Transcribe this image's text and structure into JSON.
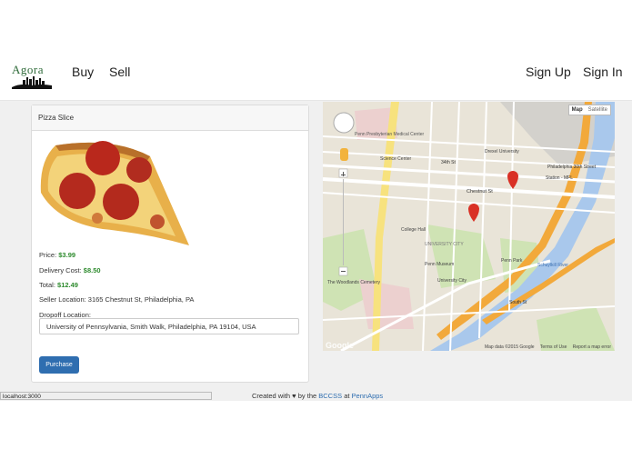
{
  "navbar": {
    "logo_text": "Agora",
    "links": {
      "buy": "Buy",
      "sell": "Sell",
      "signup": "Sign Up",
      "signin": "Sign In"
    }
  },
  "item": {
    "title": "Pizza Slice",
    "price_label": "Price:",
    "price": "$3.99",
    "delivery_label": "Delivery Cost:",
    "delivery": "$8.50",
    "total_label": "Total:",
    "total": "$12.49",
    "seller_location": "Seller Location: 3165 Chestnut St, Philadelphia, PA",
    "dropoff_label": "Dropoff Location:",
    "dropoff_value": "University of Pennsylvania, Smith Walk, Philadelphia, PA 19104, USA",
    "purchase_button": "Purchase"
  },
  "map": {
    "type_map": "Map",
    "type_satellite": "Satellite",
    "brand": "Google",
    "data_notice": "Map data ©2015 Google",
    "terms": "Terms of Use",
    "report": "Report a map error",
    "labels": {
      "presbyterian": "Penn Presbyterian Medical Center",
      "drexel": "Drexel University",
      "science_center": "Science Center",
      "st34": "34th St",
      "chestnut": "Chestnut St",
      "phil30": "Philadelphia 30th Street",
      "station": "Station - MFL",
      "college_hall": "College Hall",
      "univ_city": "UNIVERSITY CITY",
      "penn_museum": "Penn Museum",
      "penn_park": "Penn Park",
      "schuylkill": "Schuylkill River",
      "woodlands": "The Woodlands Cemetery",
      "univ_city2": "University City",
      "south_st": "South St"
    },
    "colors": {
      "water": "#a9c8ec",
      "highway": "#f2a93b",
      "park": "#cfe3b4",
      "marker": "#d93025"
    }
  },
  "status_bar": {
    "url": "localhost:3000"
  },
  "footer": {
    "created": "Created with ♥ by the",
    "bccss": "BCCSS",
    "at": "at",
    "pennapps": "PennApps"
  }
}
